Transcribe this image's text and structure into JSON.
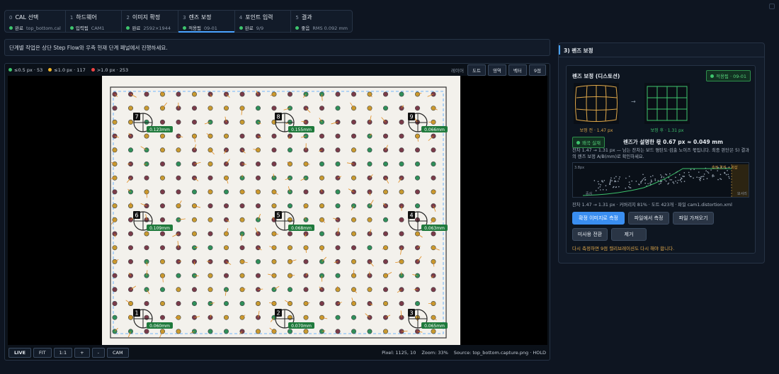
{
  "steps": [
    {
      "num": "0",
      "title": "CAL 선택",
      "status": "완료",
      "detail": "top_bottom.cal",
      "color": "#3ec46d"
    },
    {
      "num": "1",
      "title": "하드웨어",
      "status": "입력됨",
      "detail": "CAM1",
      "color": "#3ec46d"
    },
    {
      "num": "2",
      "title": "이미지 확정",
      "status": "완료",
      "detail": "2592×1944",
      "color": "#3ec46d"
    },
    {
      "num": "3",
      "title": "렌즈 보정",
      "status": "적용됨",
      "detail": "09-01",
      "color": "#3ec46d"
    },
    {
      "num": "4",
      "title": "포인트 입력",
      "status": "완료",
      "detail": "9/9",
      "color": "#3ec46d"
    },
    {
      "num": "5",
      "title": "결과",
      "status": "좋음",
      "detail": "RMS 0.092 mm",
      "color": "#3ec46d"
    }
  ],
  "message": "단계별 작업은 상단 Step Flow와 우측 현재 단계 패널에서 진행하세요.",
  "viewer": {
    "legend": [
      {
        "label": "≤0.5 px · 53",
        "color": "#3ec46d"
      },
      {
        "label": "≤1.0 px · 117",
        "color": "#f0b429"
      },
      {
        "label": ">1.0 px · 253",
        "color": "#ef4444"
      }
    ],
    "layers_label": "레이어",
    "layer_buttons": [
      "도트",
      "영역",
      "벡터",
      "9점"
    ],
    "markers": [
      {
        "num": "7",
        "value": "0.123mm"
      },
      {
        "num": "8",
        "value": "0.155mm"
      },
      {
        "num": "9",
        "value": "0.066mm"
      },
      {
        "num": "6",
        "value": "0.109mm"
      },
      {
        "num": "5",
        "value": "0.068mm"
      },
      {
        "num": "4",
        "value": "0.063mm"
      },
      {
        "num": "1",
        "value": "0.060mm"
      },
      {
        "num": "2",
        "value": "0.070mm"
      },
      {
        "num": "3",
        "value": "0.065mm"
      }
    ],
    "controls": [
      "LIVE",
      "FIT",
      "1:1",
      "+",
      "-",
      "CAM"
    ],
    "pixel": "Pixel: 1125, 10",
    "zoom": "Zoom: 33%",
    "source": "Source: top_bottom.capture.png · HOLD"
  },
  "panel": {
    "title": "3) 렌즈 보정",
    "card_title": "렌즈 보정 (디스토션)",
    "status_badge": "적용됨 · 09-01",
    "before_caption": "보정 전 · 1.47 px",
    "after_caption": "보정 후 · 1.31 px",
    "arrow": "→",
    "effect_badge": "왜곡 실재",
    "effect_text": "렌즈가 설명한 몫 0.67 px ≈ 0.049 mm",
    "explain": "잔차 1.47 → 1.31 px — 남는 잔차는 보드 평탄도·검출 노이즈 몫입니다. 최종 판단은 5) 결과의 렌즈 보정 A/B(mm)로 확인하세요.",
    "chart_ylabel": "3.8px",
    "chart_xleft": "중심",
    "chart_xright": "모서리",
    "chart_legend": "측정 경계 → 외삽",
    "stats": "잔차 1.47 → 1.31 px · 커버리지 81% · 도트 423개 · 파일 cam1.distortion.xml",
    "buttons": [
      "확정 이미지로 측정",
      "파일에서 측정",
      "파일 가져오기",
      "미사용 전환",
      "제거"
    ],
    "warning": "다시 측정하면 9점 캘리브레이션도 다시 해야 합니다."
  }
}
